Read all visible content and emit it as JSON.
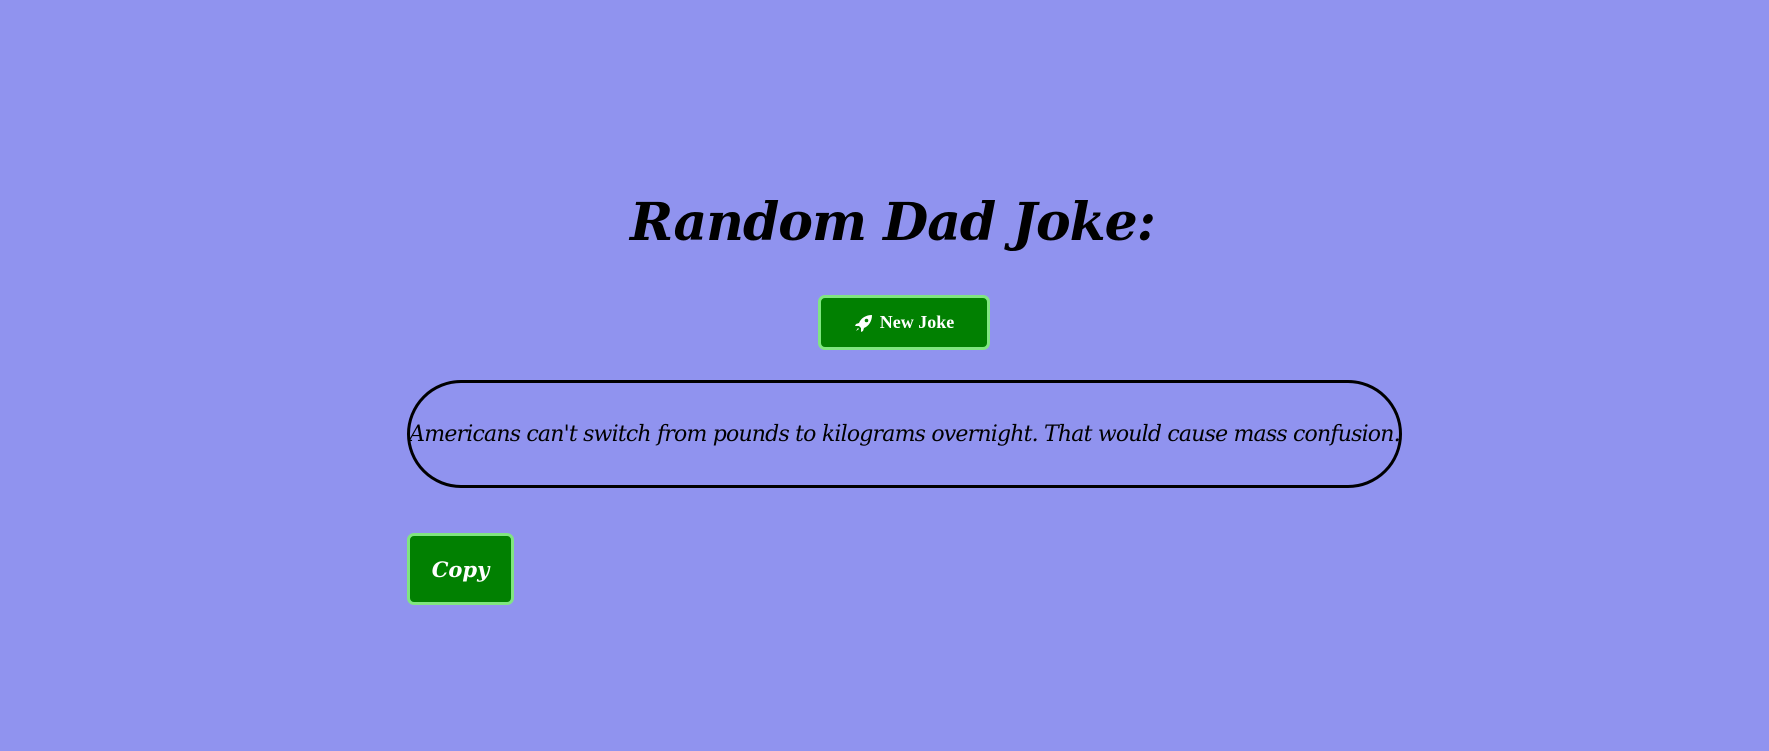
{
  "header": {
    "title": "Random Dad Joke:"
  },
  "actions": {
    "new_joke_label": "New Joke",
    "new_joke_icon": "rocket-icon",
    "copy_label": "Copy"
  },
  "joke": {
    "text": "Americans can't switch from pounds to kilograms overnight. That would cause mass confusion."
  },
  "colors": {
    "background": "#9093ef",
    "button": "#018001",
    "button_border": "#80e680",
    "text": "#000000"
  }
}
